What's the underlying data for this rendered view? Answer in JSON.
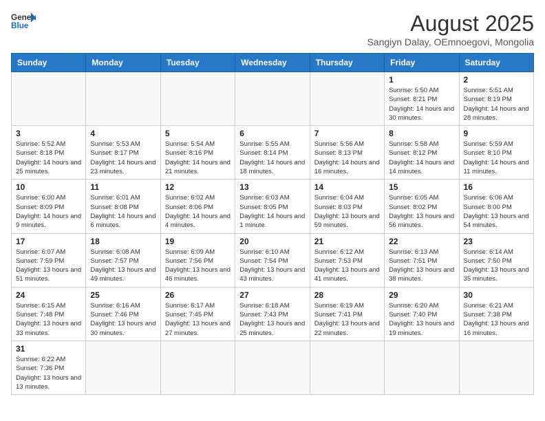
{
  "header": {
    "logo_general": "General",
    "logo_blue": "Blue",
    "title": "August 2025",
    "subtitle": "Sangiyn Dalay, OEmnoegovi, Mongolia"
  },
  "weekdays": [
    "Sunday",
    "Monday",
    "Tuesday",
    "Wednesday",
    "Thursday",
    "Friday",
    "Saturday"
  ],
  "weeks": [
    [
      {
        "day": "",
        "info": ""
      },
      {
        "day": "",
        "info": ""
      },
      {
        "day": "",
        "info": ""
      },
      {
        "day": "",
        "info": ""
      },
      {
        "day": "",
        "info": ""
      },
      {
        "day": "1",
        "info": "Sunrise: 5:50 AM\nSunset: 8:21 PM\nDaylight: 14 hours and 30 minutes."
      },
      {
        "day": "2",
        "info": "Sunrise: 5:51 AM\nSunset: 8:19 PM\nDaylight: 14 hours and 28 minutes."
      }
    ],
    [
      {
        "day": "3",
        "info": "Sunrise: 5:52 AM\nSunset: 8:18 PM\nDaylight: 14 hours and 25 minutes."
      },
      {
        "day": "4",
        "info": "Sunrise: 5:53 AM\nSunset: 8:17 PM\nDaylight: 14 hours and 23 minutes."
      },
      {
        "day": "5",
        "info": "Sunrise: 5:54 AM\nSunset: 8:16 PM\nDaylight: 14 hours and 21 minutes."
      },
      {
        "day": "6",
        "info": "Sunrise: 5:55 AM\nSunset: 8:14 PM\nDaylight: 14 hours and 18 minutes."
      },
      {
        "day": "7",
        "info": "Sunrise: 5:56 AM\nSunset: 8:13 PM\nDaylight: 14 hours and 16 minutes."
      },
      {
        "day": "8",
        "info": "Sunrise: 5:58 AM\nSunset: 8:12 PM\nDaylight: 14 hours and 14 minutes."
      },
      {
        "day": "9",
        "info": "Sunrise: 5:59 AM\nSunset: 8:10 PM\nDaylight: 14 hours and 11 minutes."
      }
    ],
    [
      {
        "day": "10",
        "info": "Sunrise: 6:00 AM\nSunset: 8:09 PM\nDaylight: 14 hours and 9 minutes."
      },
      {
        "day": "11",
        "info": "Sunrise: 6:01 AM\nSunset: 8:08 PM\nDaylight: 14 hours and 6 minutes."
      },
      {
        "day": "12",
        "info": "Sunrise: 6:02 AM\nSunset: 8:06 PM\nDaylight: 14 hours and 4 minutes."
      },
      {
        "day": "13",
        "info": "Sunrise: 6:03 AM\nSunset: 8:05 PM\nDaylight: 14 hours and 1 minute."
      },
      {
        "day": "14",
        "info": "Sunrise: 6:04 AM\nSunset: 8:03 PM\nDaylight: 13 hours and 59 minutes."
      },
      {
        "day": "15",
        "info": "Sunrise: 6:05 AM\nSunset: 8:02 PM\nDaylight: 13 hours and 56 minutes."
      },
      {
        "day": "16",
        "info": "Sunrise: 6:06 AM\nSunset: 8:00 PM\nDaylight: 13 hours and 54 minutes."
      }
    ],
    [
      {
        "day": "17",
        "info": "Sunrise: 6:07 AM\nSunset: 7:59 PM\nDaylight: 13 hours and 51 minutes."
      },
      {
        "day": "18",
        "info": "Sunrise: 6:08 AM\nSunset: 7:57 PM\nDaylight: 13 hours and 49 minutes."
      },
      {
        "day": "19",
        "info": "Sunrise: 6:09 AM\nSunset: 7:56 PM\nDaylight: 13 hours and 46 minutes."
      },
      {
        "day": "20",
        "info": "Sunrise: 6:10 AM\nSunset: 7:54 PM\nDaylight: 13 hours and 43 minutes."
      },
      {
        "day": "21",
        "info": "Sunrise: 6:12 AM\nSunset: 7:53 PM\nDaylight: 13 hours and 41 minutes."
      },
      {
        "day": "22",
        "info": "Sunrise: 6:13 AM\nSunset: 7:51 PM\nDaylight: 13 hours and 38 minutes."
      },
      {
        "day": "23",
        "info": "Sunrise: 6:14 AM\nSunset: 7:50 PM\nDaylight: 13 hours and 35 minutes."
      }
    ],
    [
      {
        "day": "24",
        "info": "Sunrise: 6:15 AM\nSunset: 7:48 PM\nDaylight: 13 hours and 33 minutes."
      },
      {
        "day": "25",
        "info": "Sunrise: 6:16 AM\nSunset: 7:46 PM\nDaylight: 13 hours and 30 minutes."
      },
      {
        "day": "26",
        "info": "Sunrise: 6:17 AM\nSunset: 7:45 PM\nDaylight: 13 hours and 27 minutes."
      },
      {
        "day": "27",
        "info": "Sunrise: 6:18 AM\nSunset: 7:43 PM\nDaylight: 13 hours and 25 minutes."
      },
      {
        "day": "28",
        "info": "Sunrise: 6:19 AM\nSunset: 7:41 PM\nDaylight: 13 hours and 22 minutes."
      },
      {
        "day": "29",
        "info": "Sunrise: 6:20 AM\nSunset: 7:40 PM\nDaylight: 13 hours and 19 minutes."
      },
      {
        "day": "30",
        "info": "Sunrise: 6:21 AM\nSunset: 7:38 PM\nDaylight: 13 hours and 16 minutes."
      }
    ],
    [
      {
        "day": "31",
        "info": "Sunrise: 6:22 AM\nSunset: 7:36 PM\nDaylight: 13 hours and 13 minutes."
      },
      {
        "day": "",
        "info": ""
      },
      {
        "day": "",
        "info": ""
      },
      {
        "day": "",
        "info": ""
      },
      {
        "day": "",
        "info": ""
      },
      {
        "day": "",
        "info": ""
      },
      {
        "day": "",
        "info": ""
      }
    ]
  ]
}
